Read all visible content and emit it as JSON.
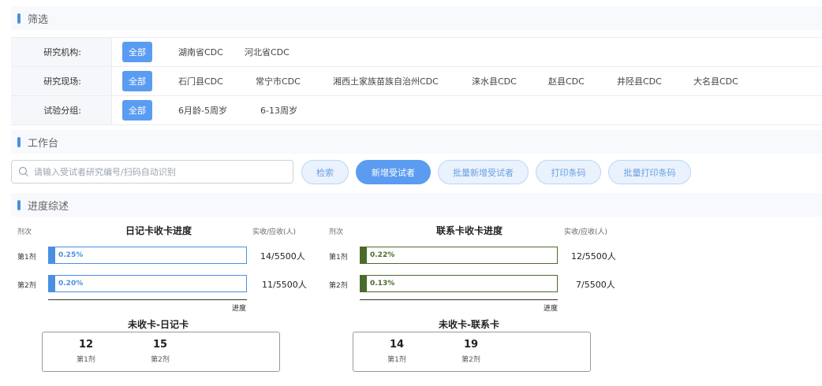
{
  "sections": {
    "filter": "筛选",
    "workbench": "工作台",
    "progress": "进度综述"
  },
  "filter": {
    "rows": [
      {
        "label": "研究机构:",
        "all": "全部",
        "options": [
          "湖南省CDC",
          "河北省CDC"
        ]
      },
      {
        "label": "研究现场:",
        "all": "全部",
        "options": [
          "石门县CDC",
          "常宁市CDC",
          "湘西土家族苗族自治州CDC",
          "涞水县CDC",
          "赵县CDC",
          "井陉县CDC",
          "大名县CDC"
        ]
      },
      {
        "label": "试验分组:",
        "all": "全部",
        "options": [
          "6月龄-5周岁",
          "6-13周岁"
        ]
      }
    ]
  },
  "workbench": {
    "search_placeholder": "请输入受试者研究编号/扫码自动识别",
    "buttons": {
      "search": "检索",
      "add": "新增受试者",
      "batch_add": "批量新增受试者",
      "print": "打印条码",
      "batch_print": "批量打印条码"
    }
  },
  "progress": {
    "charts": [
      {
        "title": "日记卡收卡进度",
        "dose_header": "剂次",
        "count_header": "实收/应收(人)",
        "axis_label": "进度",
        "color": "#4a90e2",
        "rows": [
          {
            "label": "第1剂",
            "percent_text": "0.25%",
            "fraction": 0.0025,
            "count": "14/5500人"
          },
          {
            "label": "第2剂",
            "percent_text": "0.20%",
            "fraction": 0.002,
            "count": "11/5500人"
          }
        ],
        "summary_title": "未收卡-日记卡",
        "summary": [
          {
            "num": "12",
            "label": "第1剂"
          },
          {
            "num": "15",
            "label": "第2剂"
          }
        ]
      },
      {
        "title": "联系卡收卡进度",
        "dose_header": "剂次",
        "count_header": "实收/应收(人)",
        "axis_label": "进度",
        "color": "#4b6b2a",
        "rows": [
          {
            "label": "第1剂",
            "percent_text": "0.22%",
            "fraction": 0.0022,
            "count": "12/5500人"
          },
          {
            "label": "第2剂",
            "percent_text": "0.13%",
            "fraction": 0.0013,
            "count": "7/5500人"
          }
        ],
        "summary_title": "未收卡-联系卡",
        "summary": [
          {
            "num": "14",
            "label": "第1剂"
          },
          {
            "num": "19",
            "label": "第2剂"
          }
        ]
      }
    ]
  }
}
